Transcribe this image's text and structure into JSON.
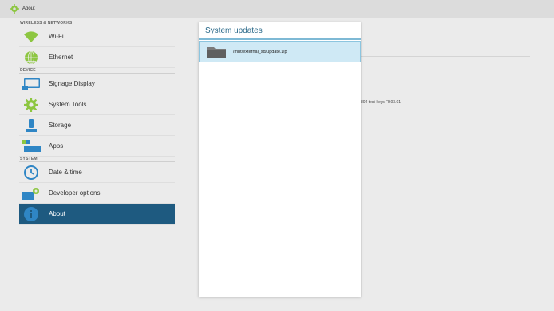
{
  "titlebar": {
    "title": "About",
    "icon": "gear-icon"
  },
  "sidebar": {
    "sections": [
      {
        "label": "WIRELESS & NETWORKS"
      },
      {
        "label": "DEVICE"
      },
      {
        "label": "SYSTEM"
      }
    ],
    "items": [
      {
        "label": "Wi-Fi",
        "icon": "wifi-icon"
      },
      {
        "label": "Ethernet",
        "icon": "globe-icon"
      },
      {
        "label": "Signage Display",
        "icon": "display-icon"
      },
      {
        "label": "System Tools",
        "icon": "gear-icon"
      },
      {
        "label": "Storage",
        "icon": "storage-icon"
      },
      {
        "label": "Apps",
        "icon": "apps-icon"
      },
      {
        "label": "Date & time",
        "icon": "clock-icon"
      },
      {
        "label": "Developer options",
        "icon": "developer-options-icon"
      },
      {
        "label": "About",
        "icon": "info-icon",
        "active": true
      }
    ]
  },
  "content": {
    "build_text": "804 test-keys FB03.01"
  },
  "dialog": {
    "title": "System updates",
    "files": [
      {
        "path": "/mnt/external_sd/update.zip",
        "icon": "folder-icon"
      }
    ]
  },
  "colors": {
    "accent": "#1e5a80",
    "dialog_title": "#2b6a8a",
    "icon_green": "#8dc641",
    "icon_blue": "#2f86c5"
  }
}
